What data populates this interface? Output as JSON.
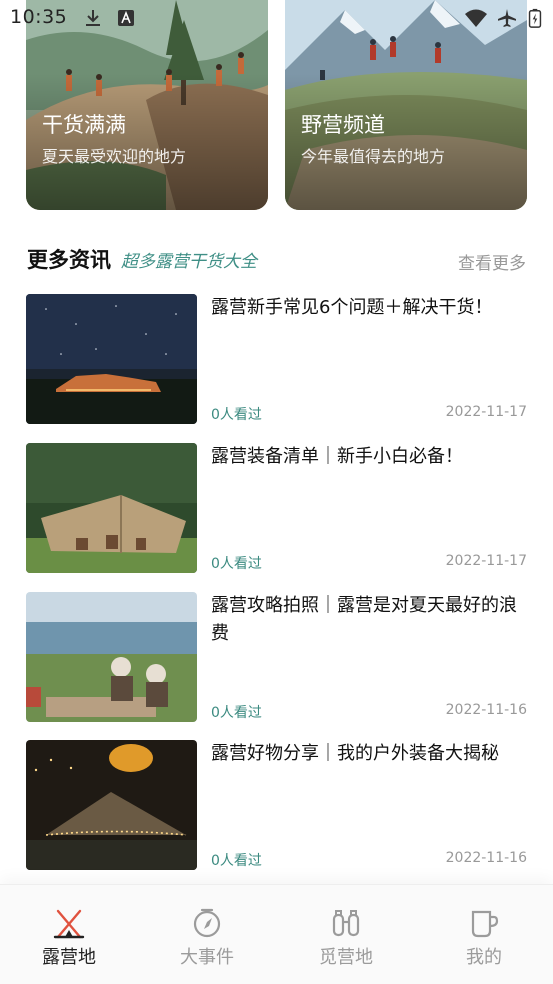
{
  "status_bar": {
    "time": "10:35"
  },
  "cards": [
    {
      "title": "干货满满",
      "subtitle": "夏天最受欢迎的地方"
    },
    {
      "title": "野营频道",
      "subtitle": "今年最值得去的地方"
    }
  ],
  "section": {
    "title": "更多资讯",
    "tag": "超多露营干货大全",
    "more": "查看更多"
  },
  "news": [
    {
      "title": "露营新手常见6个问题＋解决干货！",
      "views": "0人看过",
      "date": "2022-11-17"
    },
    {
      "title": "露营装备清单｜新手小白必备！",
      "views": "0人看过",
      "date": "2022-11-17"
    },
    {
      "title": "露营攻略拍照｜露营是对夏天最好的浪费",
      "views": "0人看过",
      "date": "2022-11-16"
    },
    {
      "title": "露营好物分享｜我的户外装备大揭秘",
      "views": "0人看过",
      "date": "2022-11-16"
    }
  ],
  "tabbar": [
    {
      "label": "露营地",
      "icon": "tent-icon",
      "active": true
    },
    {
      "label": "大事件",
      "icon": "compass-icon",
      "active": false
    },
    {
      "label": "觅营地",
      "icon": "binoculars-icon",
      "active": false
    },
    {
      "label": "我的",
      "icon": "cup-icon",
      "active": false
    }
  ],
  "colors": {
    "accent": "#3b8a80",
    "tab_active_icon": "#e0523f"
  }
}
